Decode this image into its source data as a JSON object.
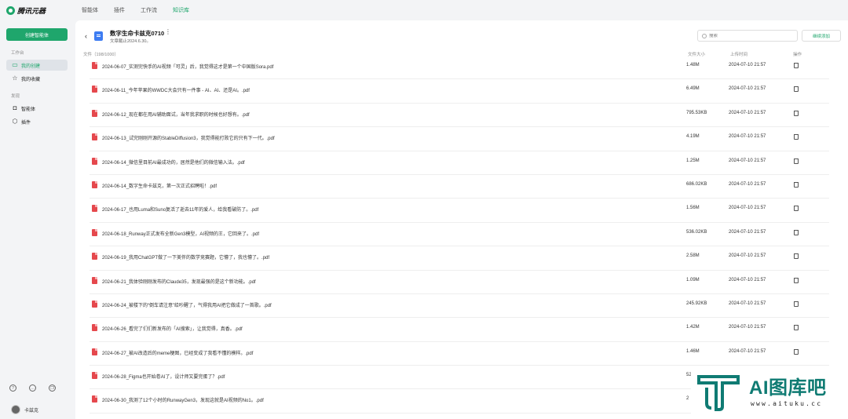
{
  "brand": {
    "name": "腾讯元器"
  },
  "sidebar": {
    "create_label": "创建智能体",
    "section_workspace": "工作台",
    "workspace_items": [
      {
        "label": "我的创建",
        "icon": "monitor-icon",
        "active": true
      },
      {
        "label": "我的收藏",
        "icon": "star-icon",
        "active": false
      }
    ],
    "section_discover": "发现",
    "discover_items": [
      {
        "label": "智能体",
        "icon": "robot-icon"
      },
      {
        "label": "插件",
        "icon": "plugin-icon"
      }
    ],
    "bottom_icons": [
      "help-icon",
      "chat-icon",
      "copy-icon"
    ],
    "user_name": "卡兹克"
  },
  "topnav": {
    "tabs": [
      "智能体",
      "插件",
      "工作流",
      "知识库"
    ],
    "active": "知识库"
  },
  "kb": {
    "title": "数字生命卡兹克0710",
    "subtitle": "文章截止2024.6.30。",
    "search_placeholder": "搜索",
    "add_label": "继续添加"
  },
  "table": {
    "headers": {
      "file": "文件（198/1000）",
      "size": "文件大小",
      "time": "上传时间",
      "action": "操作"
    },
    "rows": [
      {
        "name": "2024-06-07_实测完快手的AI视频「可灵」后，我觉得这才是第一个中国版Sora.pdf",
        "size": "1.48M",
        "time": "2024-07-10 21:57"
      },
      {
        "name": "2024-06-11_今年苹果的WWDC大会只有一件事 - AI、AI、还是AI。.pdf",
        "size": "6.49M",
        "time": "2024-07-10 21:57"
      },
      {
        "name": "2024-06-12_现在都在用AI辅助面试，当年我求职的时候也好想有。.pdf",
        "size": "795.53KB",
        "time": "2024-07-10 21:57"
      },
      {
        "name": "2024-06-13_试完刚刚开源的StableDiffusion3，我觉得能打败它的只有下一代。.pdf",
        "size": "4.19M",
        "time": "2024-07-10 21:57"
      },
      {
        "name": "2024-06-14_微信里目前AI最成功的，居然是他们的微信输入法。.pdf",
        "size": "1.25M",
        "time": "2024-07-10 21:57"
      },
      {
        "name": "2024-06-14_数字生命卡兹克，第一次正式招聘啦！.pdf",
        "size": "686.02KB",
        "time": "2024-07-10 21:57"
      },
      {
        "name": "2024-06-17_也用Luma和Suno复活了逝去11年的爱人，给我看破防了。.pdf",
        "size": "1.56M",
        "time": "2024-07-10 21:57"
      },
      {
        "name": "2024-06-18_Runway正式发布全新Gen3模型，AI视频的王，它回来了。.pdf",
        "size": "536.02KB",
        "time": "2024-07-10 21:57"
      },
      {
        "name": "2024-06-19_我用ChatGPT做了一下美伴的数学竞赛题，它懵了，我也懵了。.pdf",
        "size": "2.58M",
        "time": "2024-07-10 21:57"
      },
      {
        "name": "2024-06-21_我体验刚刚发布的Claude35，发现最强的是这个新功能。.pdf",
        "size": "1.09M",
        "time": "2024-07-10 21:57"
      },
      {
        "name": "2024-06-24_被楼下的“倒车请注意”给吵醒了，气得我用AI把它做成了一首歌。.pdf",
        "size": "245.92KB",
        "time": "2024-07-10 21:57"
      },
      {
        "name": "2024-06-26_看完了们们新发布的「AI搜索」，让我觉得，真香。.pdf",
        "size": "1.42M",
        "time": "2024-07-10 21:57"
      },
      {
        "name": "2024-06-27_被AI改造后的meme梗图，已经变成了我看不懂的模样。.pdf",
        "size": "1.46M",
        "time": "2024-07-10 21:57"
      },
      {
        "name": "2024-06-28_Figma也开始卷AI了，设计师又要完蛋了？.pdf",
        "size": "52",
        "time": ""
      },
      {
        "name": "2024-06-30_我测了12个小时的RunwayGen3，发现这就是AI视频的No1。.pdf",
        "size": "2",
        "time": ""
      }
    ]
  },
  "watermark": {
    "text": "AI图库吧",
    "url": "www.aituku.cc",
    "color": "#0f7b73"
  }
}
